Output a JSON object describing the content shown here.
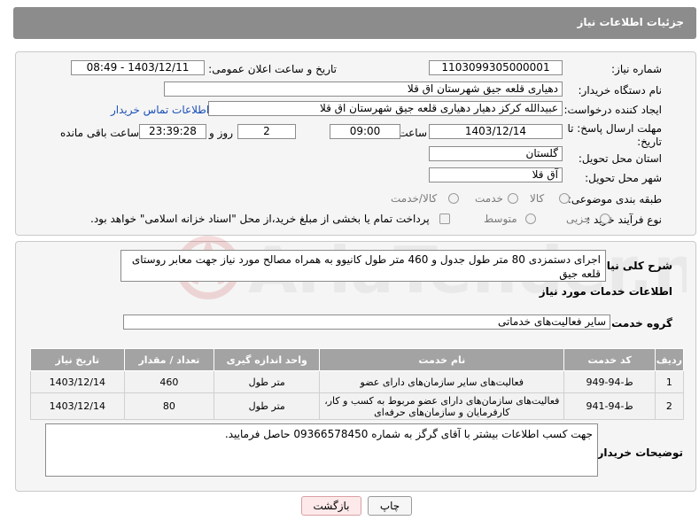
{
  "header": {
    "title": "جزئیات اطلاعات نیاز"
  },
  "info": {
    "need_number_label": "شماره نیاز:",
    "need_number": "1103099305000001",
    "announce_label": "تاریخ و ساعت اعلان عمومی:",
    "announce_value": "1403/12/11 - 08:49",
    "buyer_org_label": "نام دستگاه خریدار:",
    "buyer_org": "دهیاری قلعه جیق شهرستان اق قلا",
    "creator_label": "ایجاد کننده درخواست:",
    "creator": "عبیدالله کرکز دهیار دهیاری قلعه جیق شهرستان اق قلا",
    "contact_link": "اطلاعات تماس خریدار",
    "deadline_label_1": "مهلت ارسال پاسخ: تا",
    "deadline_label_2": "تاریخ:",
    "deadline_date": "1403/12/14",
    "time_label": "ساعت",
    "deadline_time": "09:00",
    "days_value": "2",
    "days_label": "روز و",
    "remaining_time": "23:39:28",
    "remaining_label": "ساعت باقی مانده",
    "province_label": "استان محل تحویل:",
    "province": "گلستان",
    "city_label": "شهر محل تحویل:",
    "city": "آق قلا",
    "category_label": "طبقه بندی موضوعی:",
    "category_options": [
      "کالا",
      "خدمت",
      "کالا/خدمت"
    ],
    "process_label": "نوع فرآیند خرید :",
    "process_options": [
      "جزیی",
      "متوسط"
    ],
    "payment_note": "پرداخت تمام یا بخشی از مبلغ خرید،از محل \"اسناد خزانه اسلامی\" خواهد بود."
  },
  "details": {
    "summary_label": "شرح کلی نیاز:",
    "summary": "اجرای دستمزدی 80 متر طول جدول و 460 متر طول کانیوو به همراه مصالح مورد نیاز جهت معابر روستای قلعه جیق",
    "services_title": "اطلاعات خدمات مورد نیاز",
    "service_group_label": "گروه خدمت:",
    "service_group": "سایر فعالیت‌های خدماتی",
    "table": {
      "headers": [
        "ردیف",
        "کد خدمت",
        "نام خدمت",
        "واحد اندازه گیری",
        "تعداد / مقدار",
        "تاریخ نیاز"
      ],
      "rows": [
        [
          "1",
          "ط-94-949",
          "فعالیت‌های سایر سازمان‌های دارای عضو",
          "متر طول",
          "460",
          "1403/12/14"
        ],
        [
          "2",
          "ط-94-941",
          "فعالیت‌های سازمان‌های دارای عضو مربوط به کسب و کار، کارفرمایان و سازمان‌های حرفه‌ای",
          "متر طول",
          "80",
          "1403/12/14"
        ]
      ]
    },
    "buyer_notes_label": "توضیحات خریدار:",
    "buyer_notes": "جهت کسب اطلاعات بیشتر با آقای گرگز به شماره 09366578450 حاصل فرمایید."
  },
  "buttons": {
    "print": "چاپ",
    "back": "بازگشت"
  },
  "watermark": {
    "text": "AriaTender.neT"
  },
  "colors": {
    "header_bg": "#8c8c8c",
    "table_header_bg": "#a3a3a3",
    "link": "#1a4fb8",
    "back_button_bg": "#fde9ea"
  }
}
